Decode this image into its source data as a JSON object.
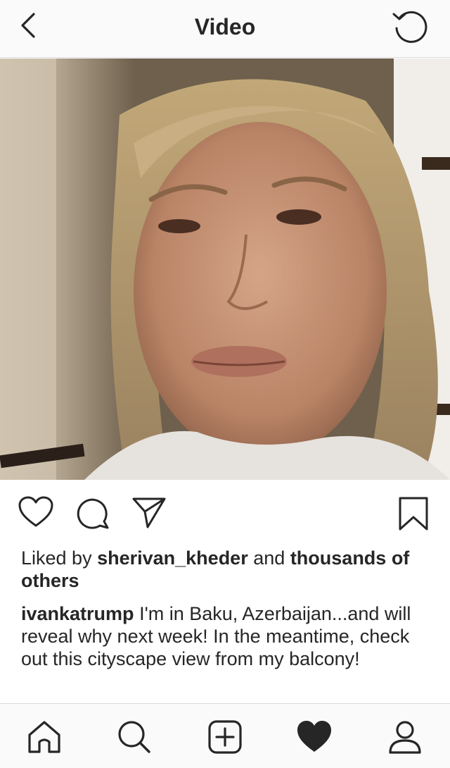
{
  "header": {
    "title": "Video",
    "back_icon": "chevron-left-icon",
    "refresh_icon": "refresh-icon"
  },
  "post": {
    "likes": {
      "prefix": "Liked by",
      "user": "sherivan_kheder",
      "joiner": "and",
      "others": "thousands of others"
    },
    "caption": {
      "username": "ivankatrump",
      "text": "I'm in Baku, Azerbaijan...and will reveal why next week! In the meantime, check out this cityscape view from my balcony!"
    }
  },
  "actions": [
    "heart-icon",
    "comment-icon",
    "send-icon",
    "bookmark-icon"
  ],
  "tabbar": [
    "home-icon",
    "search-icon",
    "add-icon",
    "heart-filled-icon",
    "profile-icon"
  ]
}
